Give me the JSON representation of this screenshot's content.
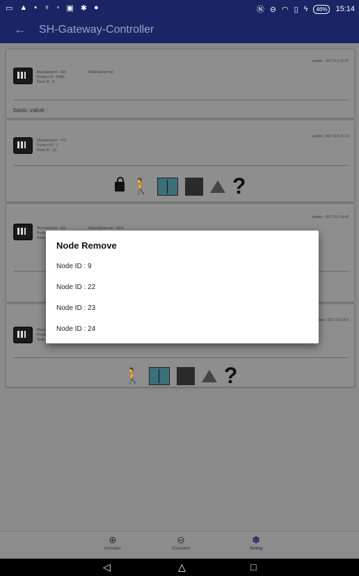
{
  "status_bar": {
    "time": "15:14",
    "battery": "46%"
  },
  "app_bar": {
    "back_glyph": "←",
    "title": "SH-Gateway-Controller"
  },
  "cards": [
    {
      "manufacturer": "Manufacturer : 265",
      "product": "Product ID : 8449",
      "node": "Node ID : 9",
      "wake": "WakeUpInterval :",
      "update": "update : 2017.9.5 22:37",
      "basic": "basic value :"
    },
    {
      "manufacturer": "Manufacturer : 270",
      "product": "Product ID : 2",
      "node": "Node ID : 22",
      "update": "update : 2017.9.5 15:14"
    },
    {
      "manufacturer": "Manufacturer : 265",
      "product": "Product ID : 8449",
      "node": "Node ID : 23",
      "wake": "WakeUpInterval : 3600",
      "update": "update : 2017.9.5 14:49"
    },
    {
      "manufacturer": "Manufacturer : 265",
      "product": "Product ID : 8449",
      "node": "Node ID : 24",
      "update": "update : 2017.9.5 15:9"
    }
  ],
  "question_mark": "?",
  "dialog": {
    "title": "Node Remove",
    "items": [
      "Node ID : 9",
      "Node ID : 22",
      "Node ID : 23",
      "Node ID : 24"
    ]
  },
  "bottom_nav": {
    "inclusion": {
      "icon": "plus-circle-icon",
      "glyph": "⊕",
      "label": "Inclusion"
    },
    "exclusion": {
      "icon": "minus-circle-icon",
      "glyph": "⊖",
      "label": "Exclusion"
    },
    "setting": {
      "icon": "gear-icon",
      "glyph": "✽",
      "label": "Setting"
    }
  },
  "system_nav": {
    "back": "◁",
    "home": "△",
    "recent": "□"
  },
  "colors": {
    "primary": "#1b2465",
    "dim_background": "#8a8a8a",
    "dialog": "#ffffff"
  }
}
